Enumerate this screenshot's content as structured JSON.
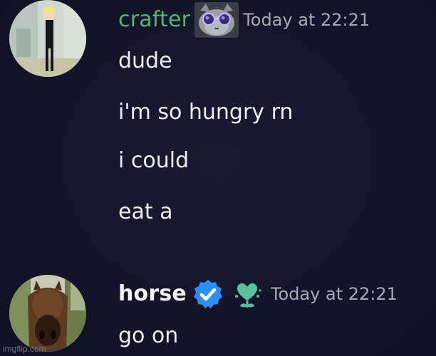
{
  "messages": [
    {
      "username": "crafter",
      "username_color": "#50b877",
      "badge_icon": "cat-sunglasses-badge-icon",
      "timestamp": "Today at 22:21",
      "lines": [
        "dude",
        "i'm so hungry rn",
        "i could",
        "eat a"
      ]
    },
    {
      "username": "horse",
      "username_color": "#f2f3f5",
      "badge_icons": [
        "verified-check-icon",
        "green-flower-heart-icon"
      ],
      "timestamp": "Today at 22:21",
      "lines": [
        "go on"
      ]
    }
  ],
  "watermark": "imgflip.com",
  "colors": {
    "background": "#13132a",
    "text": "#eceef1",
    "timestamp": "#a7a9b3",
    "verified_blue": "#2f8ef5",
    "flower_green": "#57c29a"
  }
}
